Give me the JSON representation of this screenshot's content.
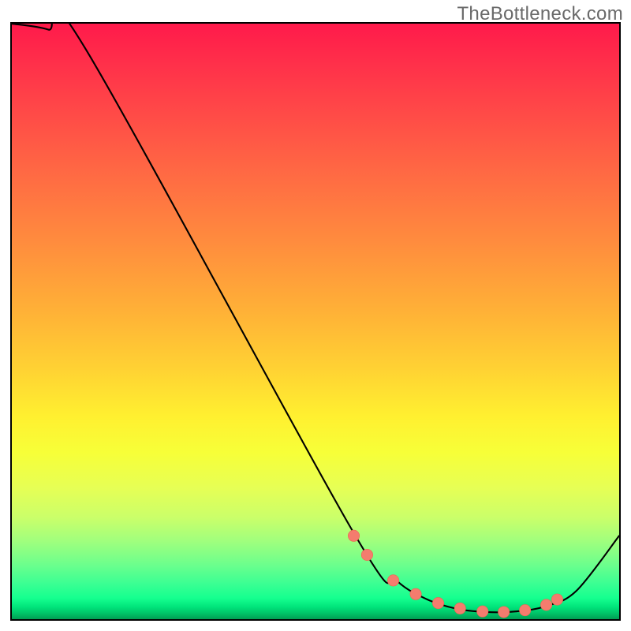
{
  "watermark": "TheBottleneck.com",
  "chart_data": {
    "type": "line",
    "title": "",
    "xlabel": "",
    "ylabel": "",
    "xlim": [
      0,
      100
    ],
    "ylim": [
      0,
      100
    ],
    "series": [
      {
        "name": "curve",
        "x": [
          0,
          6,
          12,
          56,
          63,
          68,
          73,
          78,
          83,
          88,
          93,
          100
        ],
        "values": [
          100,
          99,
          96,
          15,
          6.8,
          3.5,
          1.8,
          1.2,
          1.3,
          2.2,
          4.8,
          14
        ]
      }
    ],
    "markers": {
      "name": "segment-markers",
      "x": [
        56.3,
        58.5,
        62.8,
        66.5,
        70.2,
        73.8,
        77.5,
        81.0,
        84.5,
        88.0,
        89.8
      ],
      "values": [
        14.0,
        10.8,
        6.5,
        4.2,
        2.7,
        1.8,
        1.3,
        1.2,
        1.5,
        2.4,
        3.3
      ]
    },
    "colors": {
      "marker_fill": "#f47c6e",
      "marker_stroke": "#f0634f",
      "line": "#000000",
      "gradient_stops": [
        "#ff1a4b",
        "#ffd233",
        "#fff030",
        "#00c468",
        "#009e53"
      ]
    }
  }
}
